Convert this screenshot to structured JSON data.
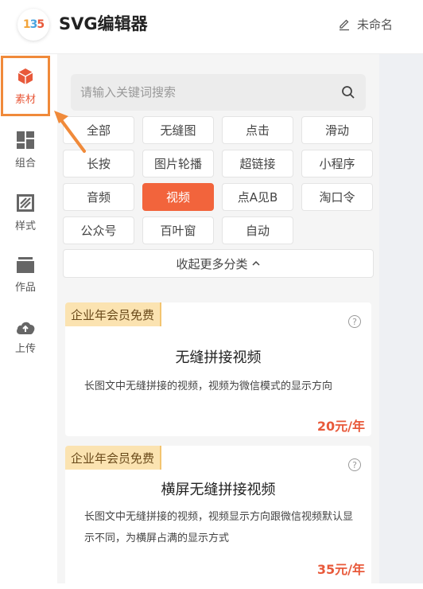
{
  "header": {
    "logo_text": "135",
    "title": "SVG编辑器",
    "rename_label": "未命名"
  },
  "sidebar": {
    "items": [
      {
        "label": "素材",
        "icon": "cube-icon",
        "active": true
      },
      {
        "label": "组合",
        "icon": "grid-icon"
      },
      {
        "label": "样式",
        "icon": "style-icon"
      },
      {
        "label": "作品",
        "icon": "folder-icon"
      },
      {
        "label": "上传",
        "icon": "upload-icon"
      }
    ]
  },
  "search": {
    "placeholder": "请输入关键词搜索"
  },
  "categories": [
    "全部",
    "无缝图",
    "点击",
    "滑动",
    "长按",
    "图片轮播",
    "超链接",
    "小程序",
    "音频",
    "视频",
    "点A见B",
    "淘口令",
    "公众号",
    "百叶窗",
    "自动"
  ],
  "selected_category": "视频",
  "collapse_label": "收起更多分类",
  "cards": [
    {
      "badge": "企业年会员免费",
      "title": "无缝拼接视频",
      "desc": "长图文中无缝拼接的视频，视频为微信模式的显示方向",
      "price": "20元/年"
    },
    {
      "badge": "企业年会员免费",
      "title": "横屏无缝拼接视频",
      "desc": "长图文中无缝拼接的视频，视频显示方向跟微信视频默认显示不同，为横屏占满的显示方式",
      "price": "35元/年"
    }
  ],
  "colors": {
    "accent": "#f2643c",
    "highlight_border": "#f08a3a",
    "badge_bg": "#fbe3b1"
  }
}
